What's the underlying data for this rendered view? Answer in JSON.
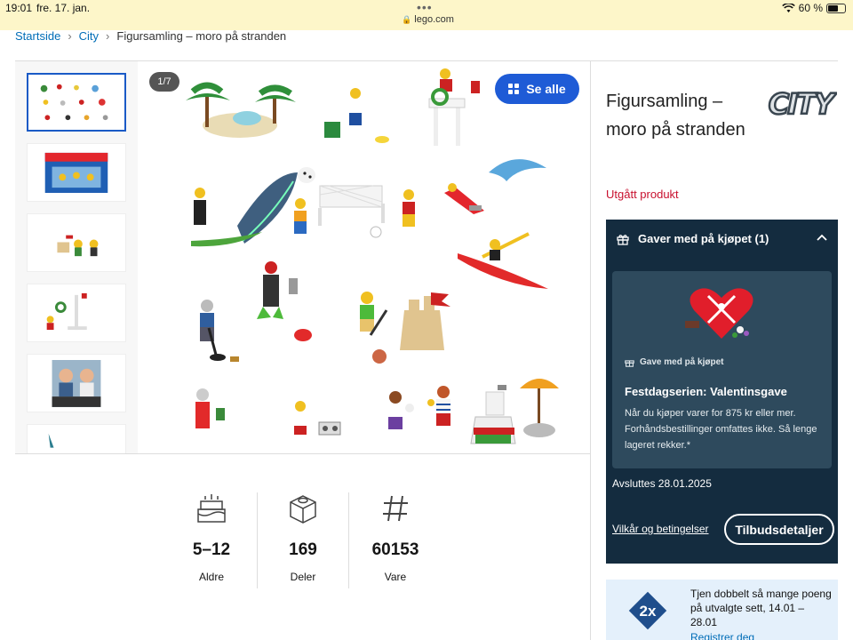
{
  "statusbar": {
    "time": "19:01",
    "date": "fre. 17. jan.",
    "dots": "•••",
    "url": "lego.com",
    "battery": "60 %",
    "battery_level": 0.6
  },
  "breadcrumb": {
    "items": [
      "Startside",
      "City"
    ],
    "separator": "›",
    "current": "Figursamling – moro på stranden"
  },
  "gallery": {
    "counter": "1/7",
    "see_all": "Se alle"
  },
  "specs": [
    {
      "value": "5–12",
      "label": "Aldre",
      "icon": "birthday-cake-icon"
    },
    {
      "value": "169",
      "label": "Deler",
      "icon": "brick-icon"
    },
    {
      "value": "60153",
      "label": "Vare",
      "icon": "hash-icon"
    }
  ],
  "product": {
    "title": "Figursamling – moro på stranden",
    "status": "Utgått produkt",
    "brand_logo_text": "CITY"
  },
  "gift": {
    "header": "Gaver med på kjøpet (1)",
    "tag": "Gave med på kjøpet",
    "title": "Festdagserien: Valentinsgave",
    "description": "Når du kjøper varer for 875 kr eller mer. Forhåndsbestillinger omfattes ikke. Så lenge lageret rekker.*",
    "ends": "Avsluttes 28.01.2025",
    "terms": "Vilkår og betingelser",
    "details": "Tilbudsdetaljer"
  },
  "promo": {
    "badge": "2x",
    "text": "Tjen dobbelt så mange poeng på utvalgte sett, 14.01 – 28.01",
    "link": "Registrer deg"
  },
  "colors": {
    "link": "#006db7",
    "see_all_bg": "#1e5bd6",
    "discontinued": "#c8102e",
    "gift_panel": "#142c3f",
    "gift_card": "#2e4a5d",
    "promo_bg": "#e4f0fb",
    "status_bar": "#fdf6c9"
  }
}
